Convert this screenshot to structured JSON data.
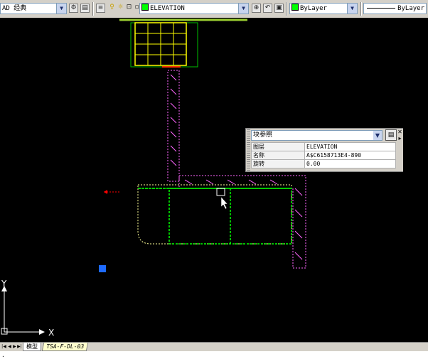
{
  "toolbar": {
    "workspace": {
      "value": "AD 经典"
    },
    "layer": {
      "value": "ELEVATION",
      "color": "#00ff00"
    },
    "color": {
      "value": "ByLayer",
      "color": "#00ff00"
    },
    "linetype": {
      "value": "ByLayer"
    },
    "icons": [
      "workspace-settings-icon",
      "workspace-save-icon",
      "layer-manager-icon",
      "layer-on-icon",
      "layer-freeze-icon",
      "layer-lock-icon",
      "layer-color-icon",
      "make-current-icon",
      "layer-previous-icon",
      "layer-isolate-icon"
    ]
  },
  "quick_properties": {
    "type": "块参照",
    "rows": [
      {
        "key": "图层",
        "value": "ELEVATION"
      },
      {
        "key": "名称",
        "value": "A$C6158713E4-890"
      },
      {
        "key": "旋转",
        "value": "0.00"
      }
    ]
  },
  "ucs": {
    "x": "X",
    "y": "Y"
  },
  "tabs": {
    "model": "模型",
    "layout": "TSA-F-DL-03"
  },
  "colors": {
    "background": "#000000",
    "green": "#00ff00",
    "yellow": "#ffff00",
    "magenta": "#ff66ff",
    "red": "#ff0000",
    "grip": "#1e6bff"
  }
}
